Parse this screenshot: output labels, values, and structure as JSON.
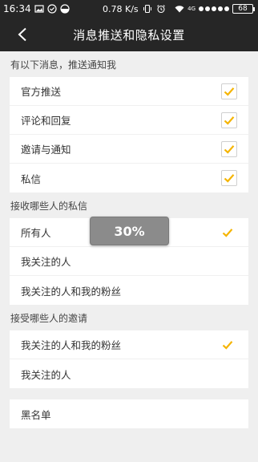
{
  "status_bar": {
    "time": "16:34",
    "net_speed": "0.78 K/s",
    "signal_label": "4G",
    "battery": "68"
  },
  "header": {
    "title": "消息推送和隐私设置"
  },
  "notifications": {
    "section_title": "有以下消息，推送通知我",
    "items": [
      {
        "label": "官方推送",
        "checked": true
      },
      {
        "label": "评论和回复",
        "checked": true
      },
      {
        "label": "邀请与通知",
        "checked": true
      },
      {
        "label": "私信",
        "checked": true
      }
    ]
  },
  "private_messages": {
    "section_title": "接收哪些人的私信",
    "options": [
      {
        "label": "所有人",
        "selected": true
      },
      {
        "label": "我关注的人",
        "selected": false
      },
      {
        "label": "我关注的人和我的粉丝",
        "selected": false
      }
    ]
  },
  "invitations": {
    "section_title": "接受哪些人的邀请",
    "options": [
      {
        "label": "我关注的人和我的粉丝",
        "selected": true
      },
      {
        "label": "我关注的人",
        "selected": false
      }
    ]
  },
  "blacklist": {
    "label": "黑名单"
  },
  "toast": {
    "text": "30%"
  },
  "colors": {
    "accent": "#f5b400",
    "bar_bg": "#262626",
    "page_bg": "#efefef"
  }
}
